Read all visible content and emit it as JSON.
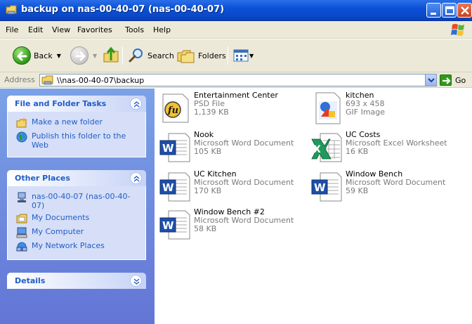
{
  "window": {
    "title": "backup on nas-00-40-07 (nas-00-40-07)"
  },
  "menu": [
    "File",
    "Edit",
    "View",
    "Favorites",
    "Tools",
    "Help"
  ],
  "toolbar": {
    "back": "Back",
    "search": "Search",
    "folders": "Folders"
  },
  "address": {
    "label": "Address",
    "value": "\\\\nas-00-40-07\\backup",
    "go": "Go"
  },
  "left": {
    "file_tasks": {
      "title": "File and Folder Tasks",
      "items": [
        "Make a new folder",
        "Publish this folder to the Web"
      ]
    },
    "other_places": {
      "title": "Other Places",
      "items": [
        "nas-00-40-07 (nas-00-40-07)",
        "My Documents",
        "My Computer",
        "My Network Places"
      ]
    },
    "details": {
      "title": "Details"
    }
  },
  "files": [
    {
      "name": "Entertainment Center",
      "type": "PSD File",
      "size": "1,139 KB",
      "icon": "psd-file-icon"
    },
    {
      "name": "kitchen",
      "type": "693 x 458",
      "size": "GIF Image",
      "icon": "gif-image-icon"
    },
    {
      "name": "Nook",
      "type": "Microsoft Word Document",
      "size": "105 KB",
      "icon": "word-document-icon"
    },
    {
      "name": "UC Costs",
      "type": "Microsoft Excel Worksheet",
      "size": "16 KB",
      "icon": "excel-worksheet-icon"
    },
    {
      "name": "UC Kitchen",
      "type": "Microsoft Word Document",
      "size": "170 KB",
      "icon": "word-document-icon"
    },
    {
      "name": "Window Bench",
      "type": "Microsoft Word Document",
      "size": "59 KB",
      "icon": "word-document-icon"
    },
    {
      "name": "Window Bench #2",
      "type": "Microsoft Word Document",
      "size": "58 KB",
      "icon": "word-document-icon"
    }
  ],
  "colors": {
    "title_bar": "#0b52d6",
    "link_blue": "#215dc6",
    "pane_gradient_top": "#7ba2e7",
    "pane_gradient_bottom": "#6375d6"
  }
}
